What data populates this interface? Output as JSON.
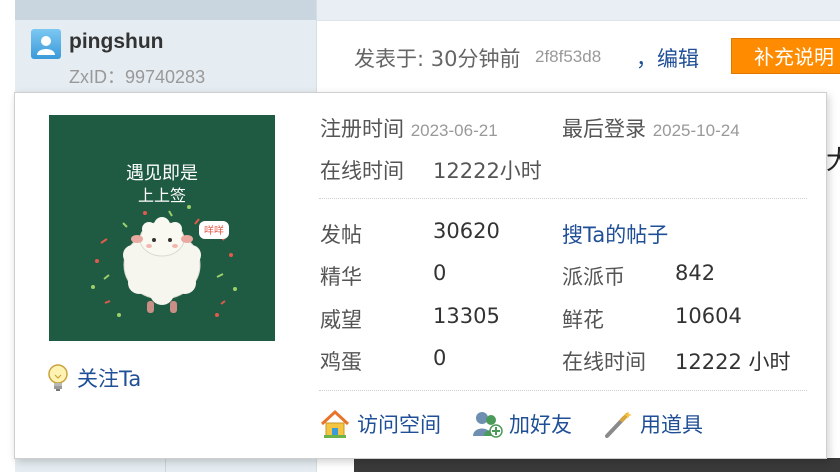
{
  "user": {
    "name": "pingshun",
    "zxid": "ZxID：99740283"
  },
  "post": {
    "posted": "发表于: 30分钟前",
    "hash": "2f8f53d8",
    "edit": "，编辑",
    "supplement": "补充说明"
  },
  "background": {
    "peek_char": "大"
  },
  "card": {
    "avatar_text_line1": "遇见即是",
    "avatar_text_line2": "上上签",
    "avatar_badge": "咩咩",
    "follow": "关注Ta",
    "reg_label": "注册时间",
    "reg_date": "2023-06-21",
    "last_label": "最后登录",
    "last_date": "2025-10-24",
    "online_label": "在线时间",
    "online_value": "12222小时",
    "stats": {
      "posts_label": "发帖",
      "posts": "30620",
      "search_link": "搜Ta的帖子",
      "digest_label": "精华",
      "digest": "0",
      "coins_label": "派派币",
      "coins": "842",
      "prestige_label": "威望",
      "prestige": "13305",
      "flowers_label": "鲜花",
      "flowers": "10604",
      "eggs_label": "鸡蛋",
      "eggs": "0",
      "online2_label": "在线时间",
      "online2": "12222 小时"
    },
    "actions": {
      "visit": "访问空间",
      "add_friend": "加好友",
      "use_item": "用道具"
    }
  },
  "colors": {
    "link": "#1f4f96",
    "accent_button": "#ff8c00",
    "avatar_bg": "#1f5a43"
  }
}
